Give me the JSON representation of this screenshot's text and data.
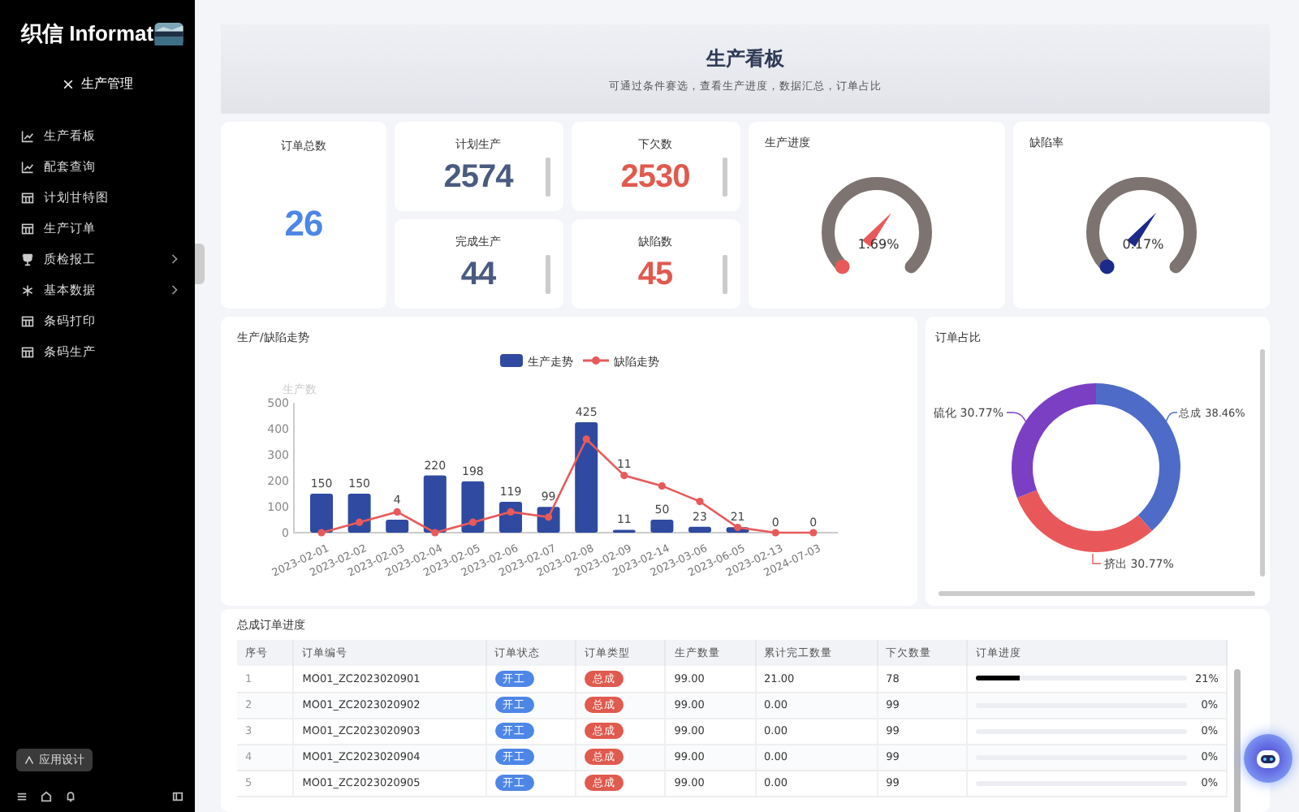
{
  "sidebar": {
    "logo": "织信 Informat",
    "app_title": "生产管理",
    "items": [
      {
        "label": "生产看板",
        "kind": "chart",
        "has_submenu": false
      },
      {
        "label": "配套查询",
        "kind": "chart",
        "has_submenu": false
      },
      {
        "label": "计划甘特图",
        "kind": "table",
        "has_submenu": false
      },
      {
        "label": "生产订单",
        "kind": "table",
        "has_submenu": false
      },
      {
        "label": "质检报工",
        "kind": "trophy",
        "has_submenu": true
      },
      {
        "label": "基本数据",
        "kind": "asterisk",
        "has_submenu": true
      },
      {
        "label": "条码打印",
        "kind": "table",
        "has_submenu": false
      },
      {
        "label": "条码生产",
        "kind": "table",
        "has_submenu": false
      }
    ],
    "design_button": "应用设计"
  },
  "banner": {
    "title": "生产看板",
    "subtitle": "可通过条件赛选，查看生产进度，数据汇总，订单占比"
  },
  "stats": [
    {
      "label": "订单总数",
      "value": "26",
      "color": "#4e86e8"
    },
    {
      "label": "计划生产",
      "value": "2574",
      "color": "#4a5a80"
    },
    {
      "label": "完成生产",
      "value": "44",
      "color": "#4a5a80"
    },
    {
      "label": "下欠数",
      "value": "2530",
      "color": "#e05a4e"
    },
    {
      "label": "缺陷数",
      "value": "45",
      "color": "#e05a4e"
    }
  ],
  "gauges": [
    {
      "title": "生产进度",
      "reading": "1.69%",
      "color": "#e85a5a"
    },
    {
      "title": "缺陷率",
      "reading": "0.17%",
      "color": "#1c2a8c"
    }
  ],
  "trend": {
    "chart_data": {
      "type": "bar",
      "title": "生产/缺陷走势",
      "ylabel": "生产数",
      "categories": [
        "2023-02-01",
        "2023-02-02",
        "2023-02-03",
        "2023-02-04",
        "2023-02-05",
        "2023-02-06",
        "2023-02-07",
        "2023-02-08",
        "2023-02-09",
        "2023-02-14",
        "2023-03-06",
        "2023-06-05",
        "2023-02-13",
        "2024-07-03"
      ],
      "series": [
        {
          "name": "生产走势",
          "type": "bar",
          "color": "#2f4aa0",
          "values": [
            150,
            150,
            50,
            220,
            198,
            119,
            99,
            425,
            11,
            50,
            23,
            21,
            0,
            0
          ],
          "value_labels": [
            "150",
            "150",
            null,
            "220",
            "198",
            "119",
            "99",
            "425",
            "11",
            "50",
            "23",
            "21",
            "0",
            "0"
          ]
        },
        {
          "name": "缺陷走势",
          "type": "line",
          "axis": "y2",
          "marker": "circle",
          "color": "#e85a5a",
          "values": [
            0,
            2,
            4,
            0,
            2,
            4,
            3,
            18,
            11,
            9,
            6,
            1,
            0,
            0
          ],
          "value_labels": [
            null,
            null,
            "4",
            null,
            null,
            null,
            null,
            null,
            "11",
            null,
            null,
            null,
            null,
            null
          ]
        }
      ],
      "ylim": [
        0,
        500
      ],
      "y2lim": [
        0,
        25
      ],
      "yticks": [
        0,
        100,
        200,
        300,
        400,
        500
      ],
      "legend": "top"
    }
  },
  "orders": {
    "chart_data": {
      "type": "donut",
      "title": "订单占比",
      "categories": [
        "总成",
        "挤出",
        "硫化"
      ],
      "values": [
        38.46,
        30.77,
        30.77
      ],
      "value_labels": [
        "38.46%",
        "30.77%",
        "30.77%"
      ]
    }
  },
  "table": {
    "title": "总成订单进度",
    "columns": [
      "序号",
      "订单编号",
      "订单状态",
      "订单类型",
      "生产数量",
      "累计完工数量",
      "下欠数量",
      "订单进度"
    ],
    "rows": [
      {
        "index": "1",
        "order_no": "MO01_ZC2023020901",
        "status": "开工",
        "type": "总成",
        "qty": "99.00",
        "done": "21.00",
        "owed": "78",
        "level": 0.21,
        "percent": "21%"
      },
      {
        "index": "2",
        "order_no": "MO01_ZC2023020902",
        "status": "开工",
        "type": "总成",
        "qty": "99.00",
        "done": "0.00",
        "owed": "99",
        "level": 0,
        "percent": "0%"
      },
      {
        "index": "3",
        "order_no": "MO01_ZC2023020903",
        "status": "开工",
        "type": "总成",
        "qty": "99.00",
        "done": "0.00",
        "owed": "99",
        "level": 0,
        "percent": "0%"
      },
      {
        "index": "4",
        "order_no": "MO01_ZC2023020904",
        "status": "开工",
        "type": "总成",
        "qty": "99.00",
        "done": "0.00",
        "owed": "99",
        "level": 0,
        "percent": "0%"
      },
      {
        "index": "5",
        "order_no": "MO01_ZC2023020905",
        "status": "开工",
        "type": "总成",
        "qty": "99.00",
        "done": "0.00",
        "owed": "99",
        "level": 0,
        "percent": "0%"
      }
    ]
  }
}
